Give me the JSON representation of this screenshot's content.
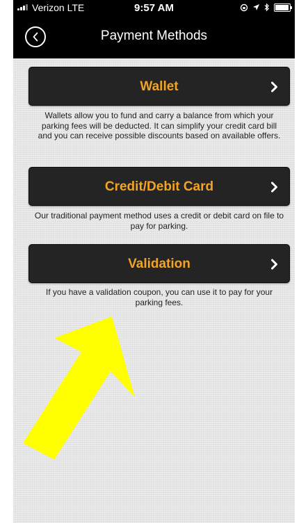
{
  "status_bar": {
    "carrier": "Verizon  LTE",
    "time": "9:57 AM"
  },
  "nav": {
    "title": "Payment Methods",
    "back_icon": "chevron-left-circle-icon"
  },
  "methods": [
    {
      "label": "Wallet",
      "description": "Wallets allow you to fund and carry a balance from which your parking fees will be deducted. It can simplify your credit card bill and you can receive possible discounts based on available offers."
    },
    {
      "label": "Credit/Debit Card",
      "description": "Our traditional payment method uses a credit or debit card on file to pay for parking."
    },
    {
      "label": "Validation",
      "description": "If you have a validation coupon, you can use it to pay for your parking fees."
    }
  ],
  "colors": {
    "accent": "#f2a422",
    "nav_background": "#000000",
    "button_background": "#242424",
    "annotation_arrow": "#ffff00"
  }
}
